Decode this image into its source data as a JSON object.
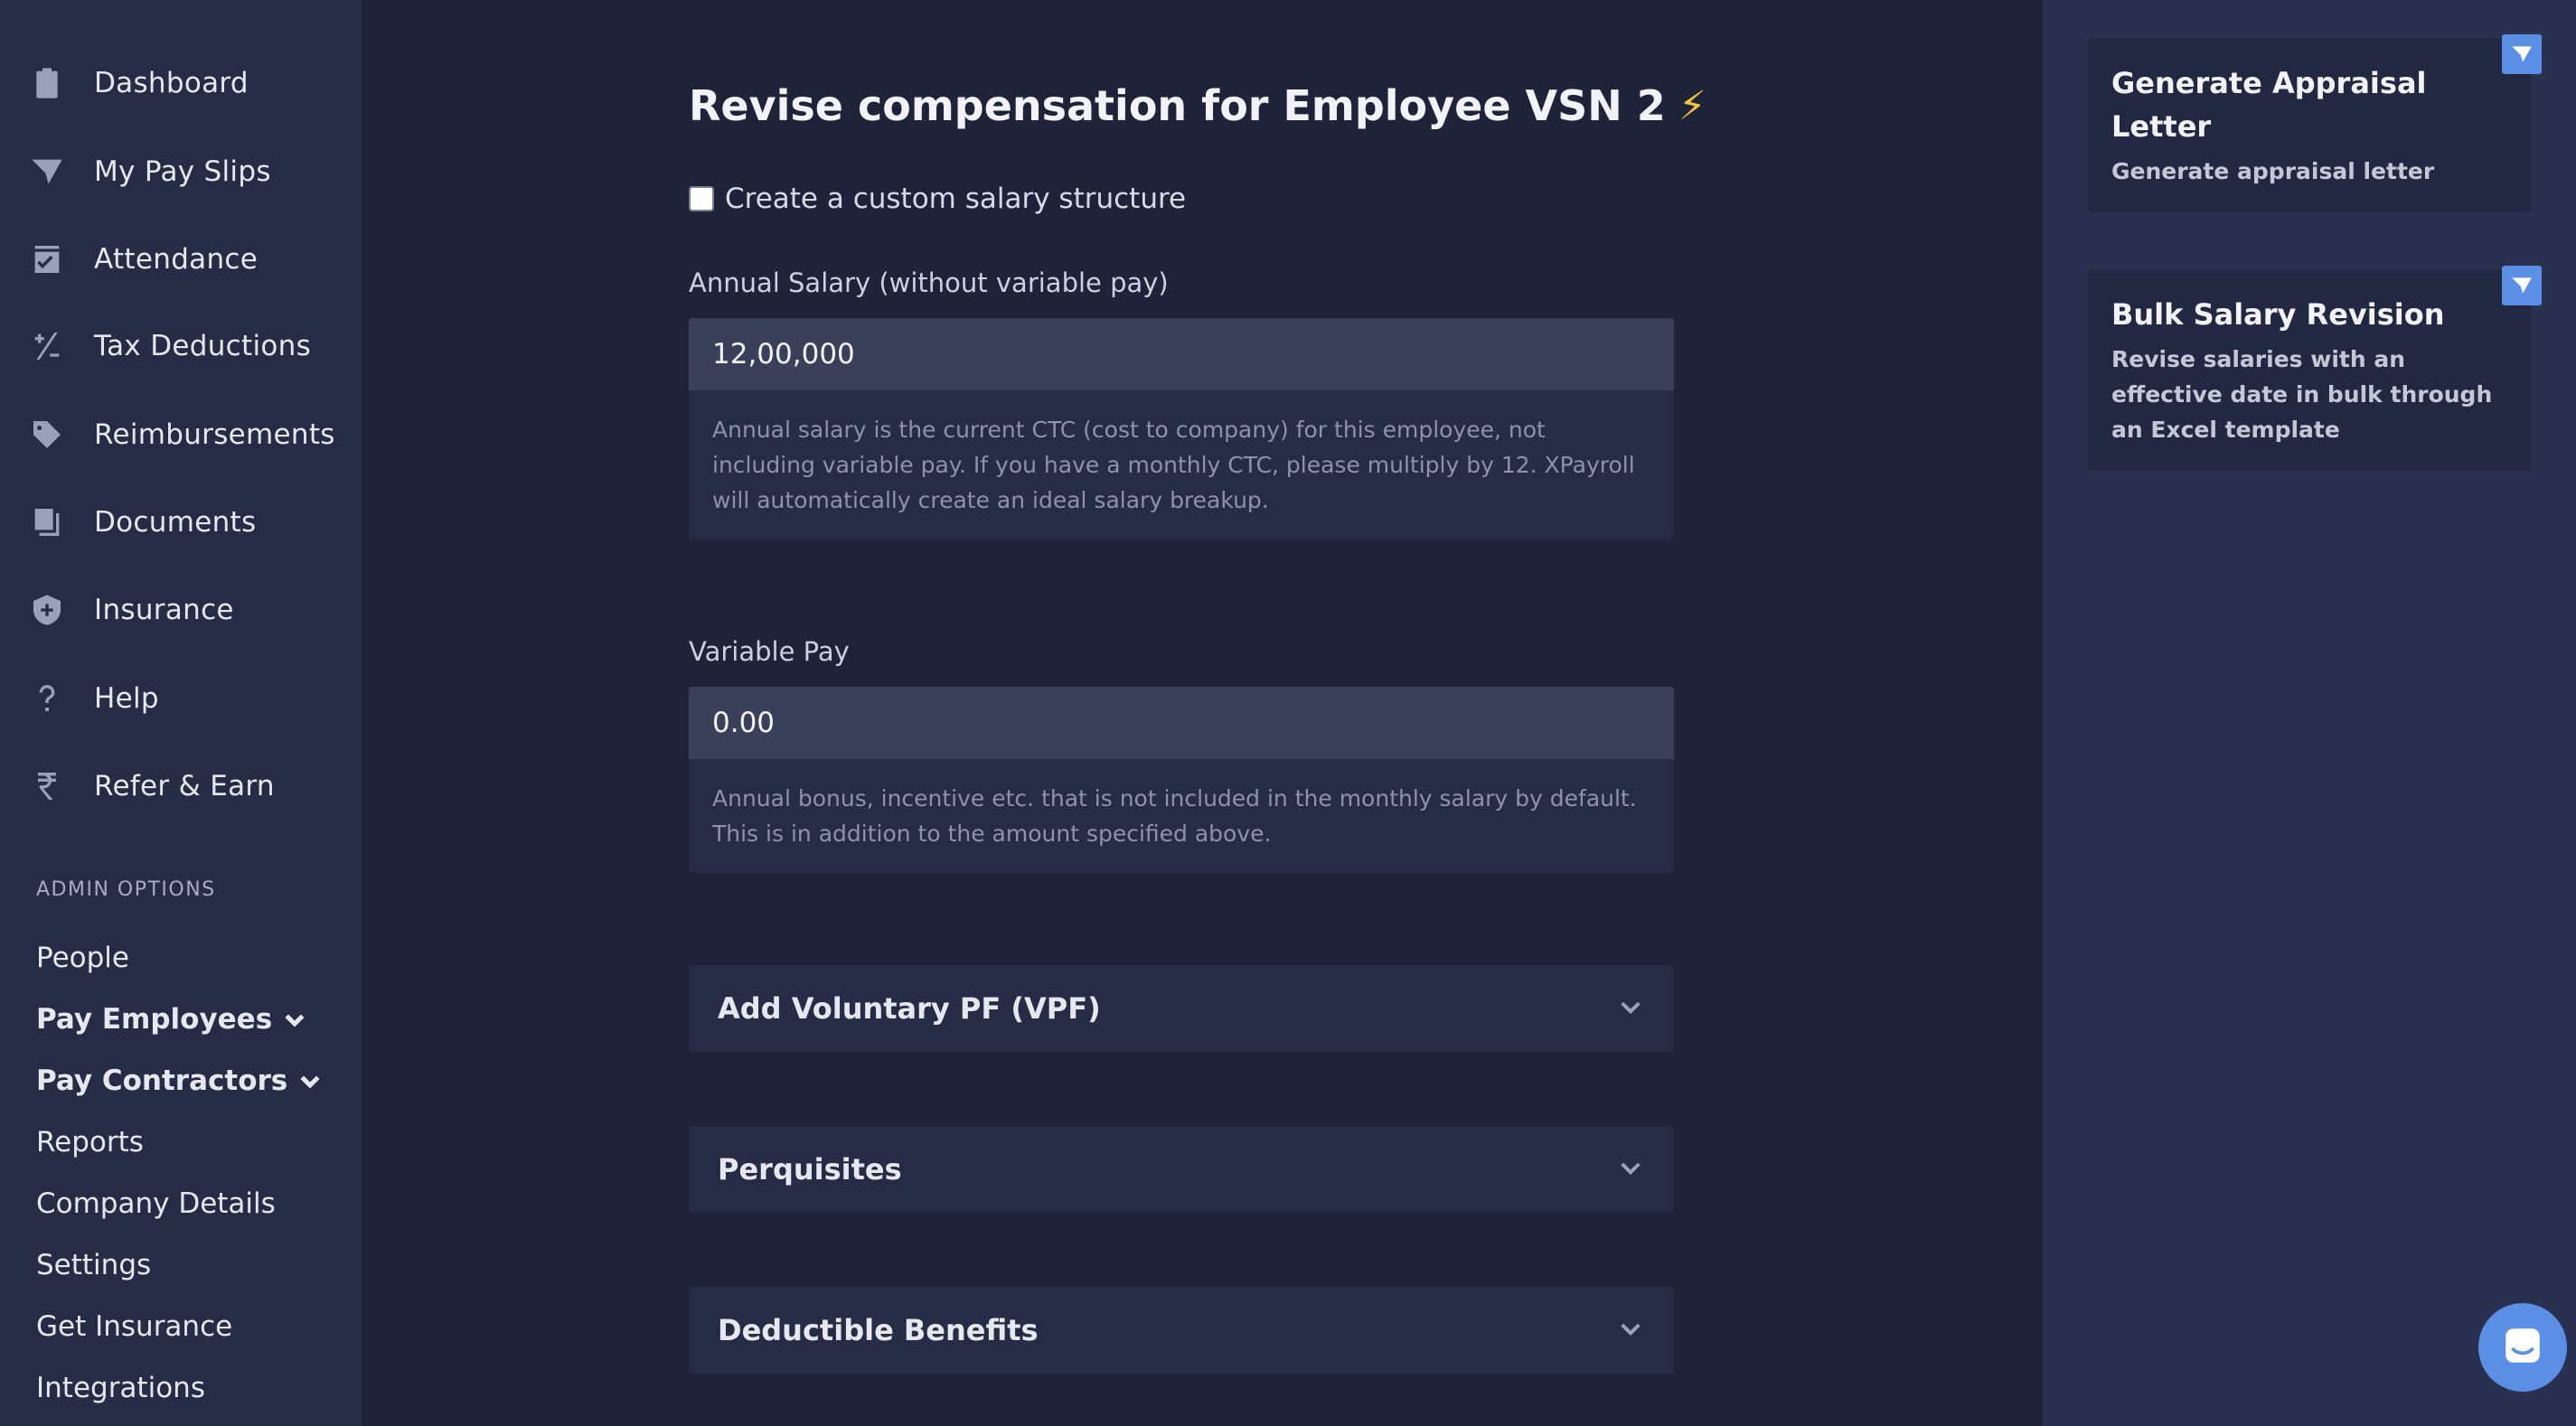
{
  "sidebar": {
    "nav": [
      {
        "label": "Dashboard",
        "icon": "clipboard-icon"
      },
      {
        "label": "My Pay Slips",
        "icon": "paper-plane-icon"
      },
      {
        "label": "Attendance",
        "icon": "calendar-check-icon"
      },
      {
        "label": "Tax Deductions",
        "icon": "plus-minus-icon"
      },
      {
        "label": "Reimbursements",
        "icon": "tag-icon"
      },
      {
        "label": "Documents",
        "icon": "documents-icon"
      },
      {
        "label": "Insurance",
        "icon": "shield-plus-icon"
      },
      {
        "label": "Help",
        "icon": "question-icon"
      },
      {
        "label": "Refer & Earn",
        "icon": "rupee-icon"
      }
    ],
    "admin_heading": "ADMIN OPTIONS",
    "admin": [
      {
        "label": "People"
      },
      {
        "label": "Pay Employees"
      },
      {
        "label": "Pay Contractors"
      },
      {
        "label": "Reports"
      },
      {
        "label": "Company Details"
      },
      {
        "label": "Settings"
      },
      {
        "label": "Get Insurance"
      },
      {
        "label": "Integrations"
      }
    ]
  },
  "main": {
    "title": "Revise compensation for Employee VSN 2",
    "title_emoji": "⚡",
    "custom_structure_label": "Create a custom salary structure",
    "annual_salary": {
      "label": "Annual Salary (without variable pay)",
      "value": "12,00,000",
      "help": "Annual salary is the current CTC (cost to company) for this employee, not including variable pay. If you have a monthly CTC, please multiply by 12. XPayroll will automatically create an ideal salary breakup."
    },
    "variable_pay": {
      "label": "Variable Pay",
      "value": "0.00",
      "help": "Annual bonus, incentive etc. that is not included in the monthly salary by default. This is in addition to the amount specified above."
    },
    "accordions": [
      {
        "label": "Add Voluntary PF (VPF)"
      },
      {
        "label": "Perquisites"
      },
      {
        "label": "Deductible Benefits"
      }
    ]
  },
  "right": {
    "cards": [
      {
        "title": "Generate Appraisal Letter",
        "subtitle": "Generate appraisal letter"
      },
      {
        "title": "Bulk Salary Revision",
        "subtitle": "Revise salaries with an effective date in bulk through an Excel template"
      }
    ]
  },
  "colors": {
    "accent": "#5b8fe6",
    "sidebar_bg": "#262b46",
    "main_bg": "#1e2339",
    "right_bg": "#2a3050"
  }
}
